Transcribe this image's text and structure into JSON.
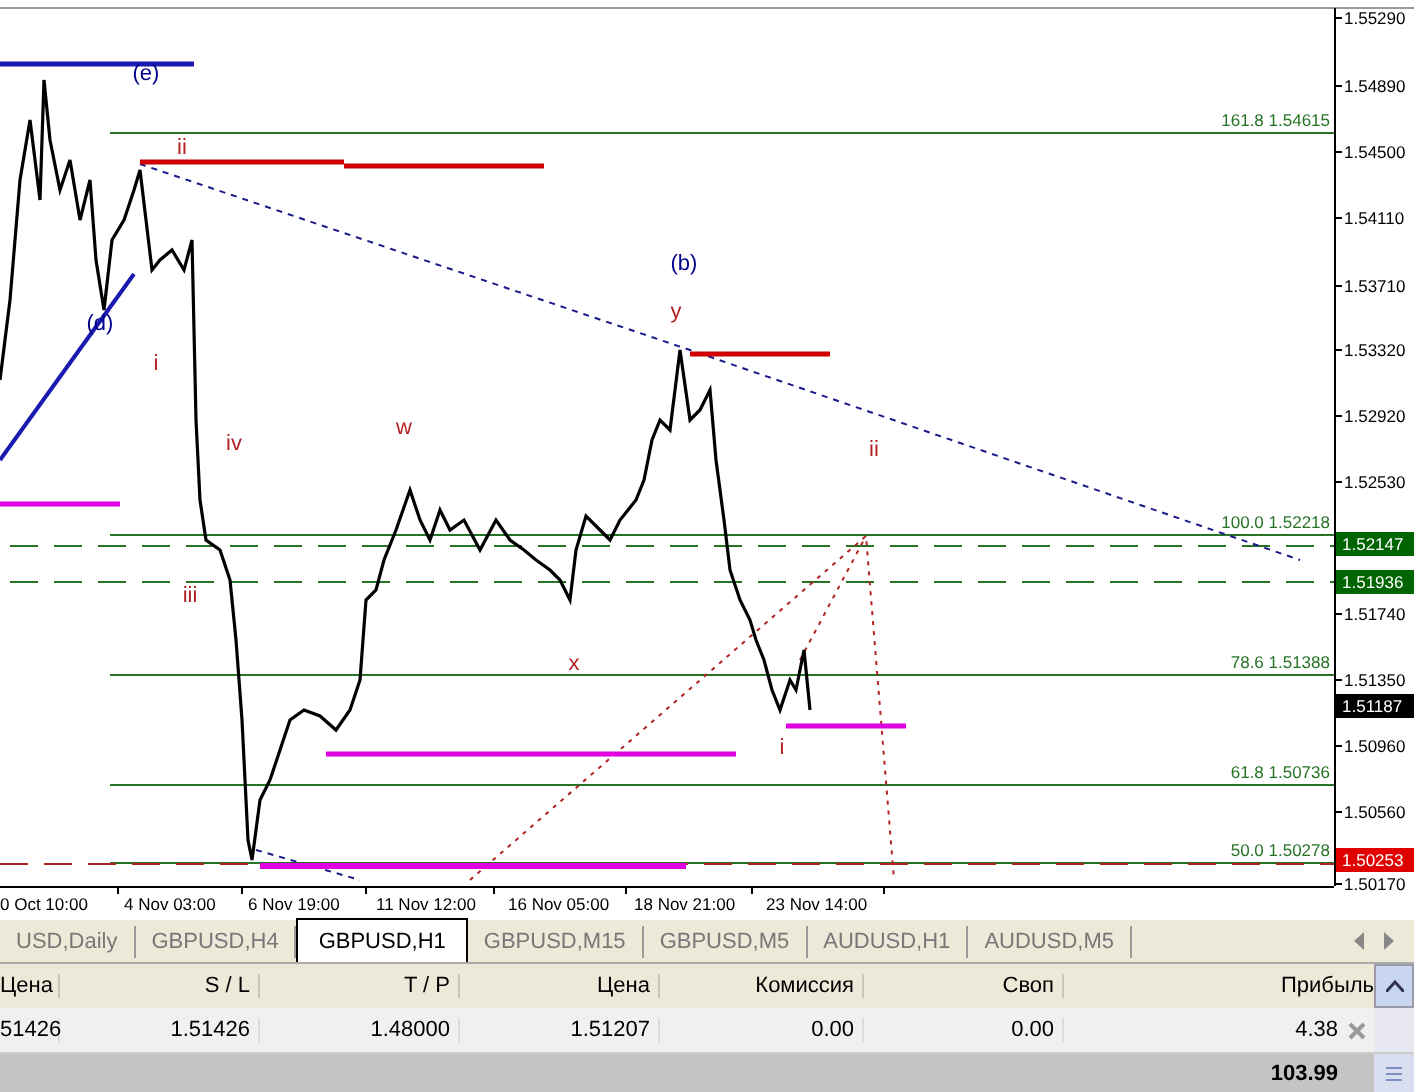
{
  "chart": {
    "y_axis_labels": [
      "1.55290",
      "1.54890",
      "1.54500",
      "1.54110",
      "1.53710",
      "1.53320",
      "1.52920",
      "1.52530",
      "1.51740",
      "1.51350",
      "1.50960",
      "1.50560",
      "1.50170"
    ],
    "price_tags": [
      {
        "text": "1.52147",
        "kind": "level"
      },
      {
        "text": "1.51936",
        "kind": "level"
      },
      {
        "text": "1.51187",
        "kind": "bid"
      },
      {
        "text": "1.50253",
        "kind": "stop"
      }
    ],
    "fib_levels": [
      "161.8 1.54615",
      "100.0 1.52218",
      "78.6 1.51388",
      "61.8 1.50736",
      "50.0 1.50278"
    ],
    "wave_labels": [
      {
        "text": "(e)",
        "color": "#00008b"
      },
      {
        "text": "ii",
        "color": "#b22222"
      },
      {
        "text": "(d)",
        "color": "#00008b"
      },
      {
        "text": "i",
        "color": "#b22222"
      },
      {
        "text": "iv",
        "color": "#b22222"
      },
      {
        "text": "w",
        "color": "#b22222"
      },
      {
        "text": "iii",
        "color": "#b22222"
      },
      {
        "text": "(b)",
        "color": "#00008b"
      },
      {
        "text": "y",
        "color": "#b22222"
      },
      {
        "text": "ii",
        "color": "#b22222"
      },
      {
        "text": "x",
        "color": "#b22222"
      },
      {
        "text": "i",
        "color": "#b22222"
      }
    ],
    "x_axis_labels": [
      "0 Oct 10:00",
      "4 Nov 03:00",
      "6 Nov 19:00",
      "11 Nov 12:00",
      "16 Nov 05:00",
      "18 Nov 21:00",
      "23 Nov 14:00"
    ]
  },
  "tabs": [
    {
      "label": "USD,Daily",
      "selected": false
    },
    {
      "label": "GBPUSD,H4",
      "selected": false
    },
    {
      "label": "GBPUSD,H1",
      "selected": true
    },
    {
      "label": "GBPUSD,M15",
      "selected": false
    },
    {
      "label": "GBPUSD,M5",
      "selected": false
    },
    {
      "label": "AUDUSD,H1",
      "selected": false
    },
    {
      "label": "AUDUSD,M5",
      "selected": false
    }
  ],
  "table": {
    "columns": [
      "Цена",
      "S / L",
      "T / P",
      "Цена",
      "Комиссия",
      "Своп",
      "Прибыль"
    ],
    "rows": [
      [
        "51426",
        "1.51426",
        "1.48000",
        "1.51207",
        "0.00",
        "0.00",
        "4.38"
      ]
    ],
    "total": "103.99"
  }
}
